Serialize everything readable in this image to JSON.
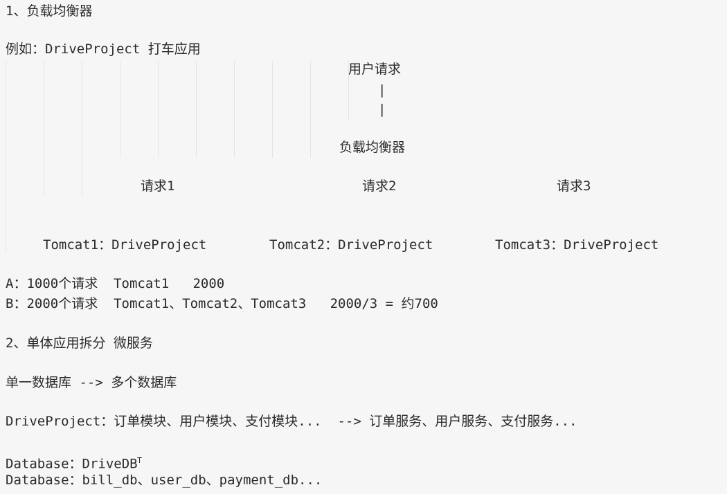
{
  "section1": {
    "title": "1、负载均衡器",
    "example": "例如：DriveProject 打车应用"
  },
  "diagram": {
    "user_request": "用户请求",
    "pipe1": "|",
    "pipe2": "|",
    "balancer": "负载均衡器",
    "req1": "请求1",
    "req2": "请求2",
    "req3": "请求3",
    "tomcat1": "Tomcat1：DriveProject",
    "tomcat2": "Tomcat2：DriveProject",
    "tomcat3": "Tomcat3：DriveProject"
  },
  "comparison": {
    "a": "A：1000个请求  Tomcat1   2000",
    "b": "B：2000个请求  Tomcat1、Tomcat2、Tomcat3   2000/3 = 约700"
  },
  "section2": {
    "title": "2、单体应用拆分 微服务",
    "db_split": "单一数据库 --> 多个数据库",
    "modules": "DriveProject：订单模块、用户模块、支付模块...  --> 订单服务、用户服务、支付服务...",
    "db_single": "Database：DriveDB",
    "cursor": "Ꭲ",
    "db_multi": "Database：bill_db、user_db、payment_db..."
  }
}
